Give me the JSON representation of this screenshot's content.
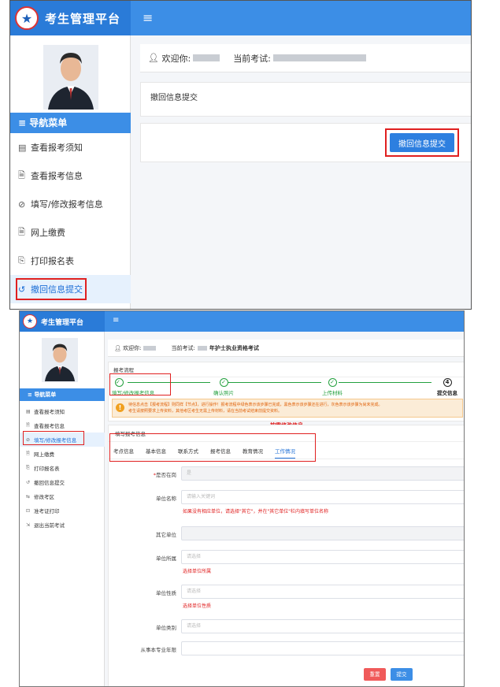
{
  "top": {
    "app_title": "考生管理平台",
    "menu_icon": "≡",
    "welcome_label": "欢迎你:",
    "exam_label": "当前考试:",
    "nav_header": "导航菜单",
    "nav_header_icon": "≡",
    "nav": [
      {
        "icon": "▤",
        "label": "查看报考须知"
      },
      {
        "icon": "🗎",
        "label": "查看报考信息"
      },
      {
        "icon": "⊘",
        "label": "填写/修改报考信息"
      },
      {
        "icon": "🗎",
        "label": "网上缴费"
      },
      {
        "icon": "⎘",
        "label": "打印报名表"
      },
      {
        "icon": "↺",
        "label": "撤回信息提交"
      }
    ],
    "panel_title": "撤回信息提交",
    "retract_button": "撤回信息提交"
  },
  "bottom": {
    "app_title": "考生管理平台",
    "menu_icon": "≡",
    "welcome_label": "欢迎你:",
    "exam_label": "当前考试:",
    "exam_name": "年护士执业资格考试",
    "nav_header": "导航菜单",
    "nav_header_icon": "≡",
    "nav": [
      {
        "icon": "▤",
        "label": "查看报考须知"
      },
      {
        "icon": "🗎",
        "label": "查看报考信息"
      },
      {
        "icon": "⊘",
        "label": "填写/修改报考信息"
      },
      {
        "icon": "🗎",
        "label": "网上缴费"
      },
      {
        "icon": "⎘",
        "label": "打印报名表"
      },
      {
        "icon": "↺",
        "label": "撤回信息提交"
      },
      {
        "icon": "⇆",
        "label": "修改考区"
      },
      {
        "icon": "⊡",
        "label": "准考证打印"
      },
      {
        "icon": "⇲",
        "label": "退出当前考试"
      }
    ],
    "steps_title": "报考流程",
    "steps": [
      {
        "label": "填写/修改报考信息",
        "mark": "✓"
      },
      {
        "label": "确认照片",
        "mark": "✓"
      },
      {
        "label": "上传材料",
        "mark": "✓"
      },
      {
        "label": "提交信息",
        "mark": "4"
      }
    ],
    "notice_icon": "!",
    "notice_line1": "待信息点击【报考流程】则同样【节点】，进行操作！报考流程中绿色表示该步骤已完成，黑色表示该步骤还在进行，灰色表示该步骤为尚未完成。",
    "notice_line2": "考生请按照要求上传资料，其他考区考生无需上传材料，请在当前考试结束前提交资料。",
    "annotation": "按需修改信息",
    "form_title": "填写报考信息",
    "tabs": [
      "考点信息",
      "基本信息",
      "联系方式",
      "报考信息",
      "教育情况",
      "工作情况"
    ],
    "active_tab": "工作情况",
    "fields": [
      {
        "label": "是否在岗",
        "required": true,
        "placeholder": "是"
      },
      {
        "label": "单位名称",
        "required": false,
        "placeholder": "请输入关键词",
        "hint": "如果没有相应单位，请选择\"其它\"，并在\"其它单位\"栏内填写单位名称"
      },
      {
        "label": "其它单位",
        "required": false,
        "placeholder": ""
      },
      {
        "label": "单位所属",
        "required": false,
        "placeholder": "请选择",
        "hint": "选择单位所属"
      },
      {
        "label": "单位性质",
        "required": false,
        "placeholder": "请选择",
        "hint": "选择单位性质"
      },
      {
        "label": "单位类别",
        "required": false,
        "placeholder": "请选择"
      },
      {
        "label": "从事本专业年限",
        "required": false,
        "placeholder": ""
      }
    ],
    "reset_button": "重置",
    "submit_button": "提交",
    "colors": {
      "primary": "#3c8ee6",
      "highlight": "#e02020",
      "done": "#23a03e",
      "reset": "#f05a5a"
    }
  }
}
